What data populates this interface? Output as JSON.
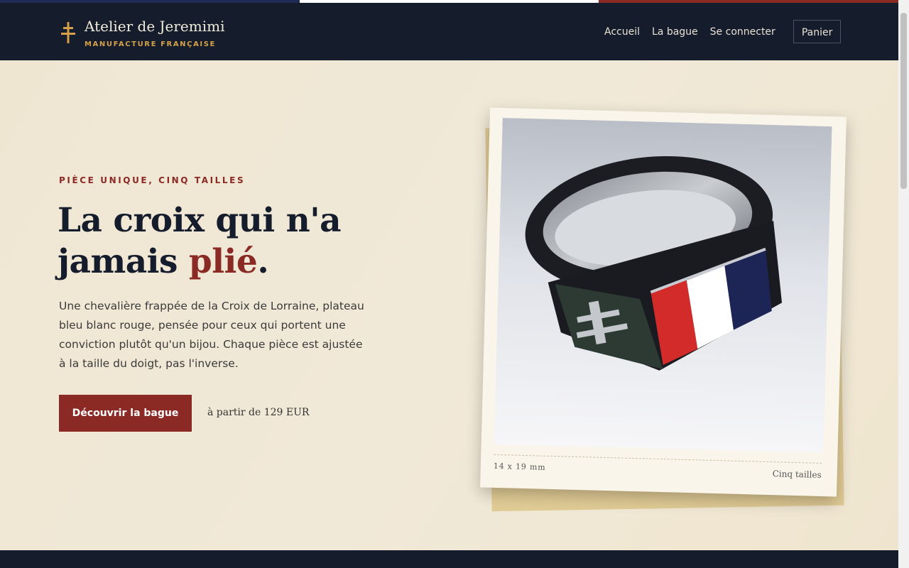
{
  "colors": {
    "navy": "#151c2b",
    "accent_red": "#8b2a25",
    "gold": "#d4a14a",
    "flag_blue": "#1f2b52",
    "flag_white": "#ffffff",
    "flag_red": "#8b2a25"
  },
  "header": {
    "brand_icon": "cross-of-lorraine-icon",
    "brand_name": "Atelier de Jeremimi",
    "brand_tagline": "MANUFACTURE FRANÇAISE",
    "nav": [
      "Accueil",
      "La bague",
      "Se connecter"
    ],
    "cart_label": "Panier"
  },
  "hero": {
    "eyebrow": "PIÈCE UNIQUE, CINQ TAILLES",
    "headline_part1": "La croix qui n'a jamais ",
    "headline_accent": "plié",
    "headline_end": ".",
    "description": "Une chevalière frappée de la Croix de Lorraine, plateau bleu blanc rouge, pensée pour ceux qui portent une conviction plutôt qu'un bijou. Chaque pièce est ajustée à la taille du doigt, pas l'inverse.",
    "cta_label": "Découvrir la bague",
    "price_text": "à partir de 129 EUR"
  },
  "product_card": {
    "dimensions": "14 x 19 mm",
    "sizes_label": "Cinq tailles"
  }
}
